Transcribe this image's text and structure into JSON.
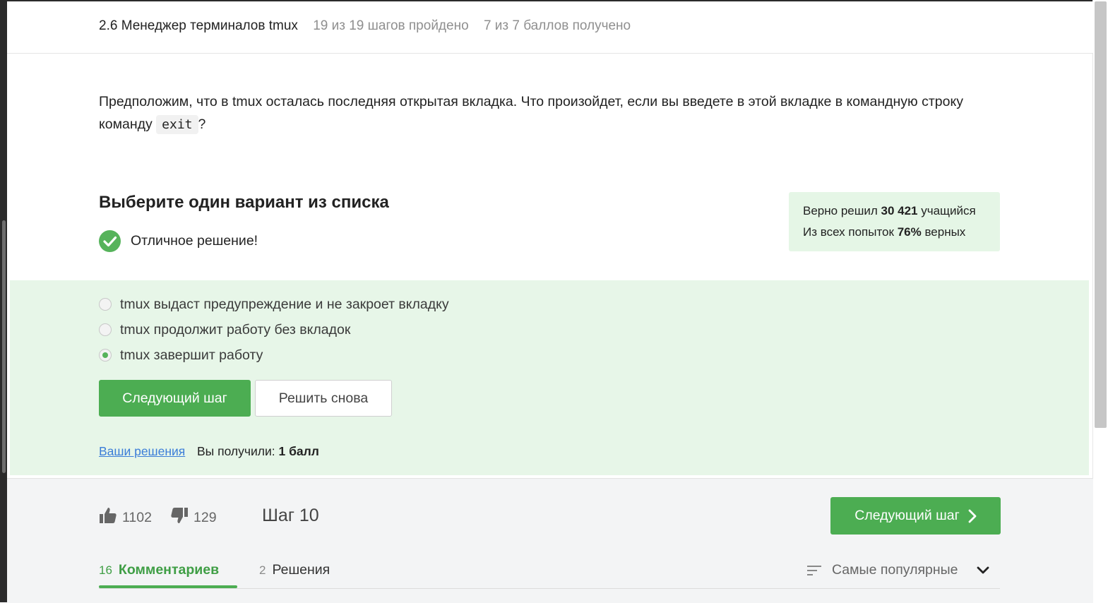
{
  "header": {
    "lesson_title": "2.6 Менеджер терминалов tmux",
    "steps_progress": "19 из 19 шагов пройдено",
    "points_progress": "7 из 7 баллов  получено"
  },
  "question": {
    "text_before": "Предположим, что в tmux осталась последняя открытая вкладка. Что произойдет, если вы введете в этой вкладке в командную строку команду ",
    "code": "exit",
    "text_after": "?"
  },
  "quiz": {
    "title": "Выберите один вариант из списка",
    "feedback": "Отличное решение!",
    "options": [
      {
        "label": "tmux выдаст предупреждение и не закроет вкладку",
        "selected": false
      },
      {
        "label": "tmux продолжит работу без вкладок",
        "selected": false
      },
      {
        "label": "tmux завершит работу",
        "selected": true
      }
    ],
    "next_button": "Следующий шаг",
    "retry_button": "Решить снова",
    "your_solutions_link": "Ваши решения",
    "score_label": "Вы получили:",
    "score_value": "1 балл"
  },
  "stats": {
    "solved_prefix": "Верно решил ",
    "solved_count": "30 421",
    "solved_suffix": " учащийся",
    "attempts_prefix": "Из всех попыток ",
    "attempts_percent": "76%",
    "attempts_suffix": " верных"
  },
  "footer": {
    "likes": "1102",
    "dislikes": "129",
    "step_label": "Шаг 10",
    "next_button": "Следующий шаг",
    "tabs": [
      {
        "count": "16",
        "label": "Комментариев",
        "active": true
      },
      {
        "count": "2",
        "label": "Решения",
        "active": false
      }
    ],
    "sort_label": "Самые популярные"
  },
  "colors": {
    "accent_green": "#4cad52",
    "success_bg": "#e7f6e8",
    "link_blue": "#3b7dd8"
  },
  "icons": [
    "check-circle-icon",
    "thumbs-up-icon",
    "thumbs-down-icon",
    "chevron-right-icon",
    "sort-lines-icon",
    "chevron-down-icon"
  ]
}
